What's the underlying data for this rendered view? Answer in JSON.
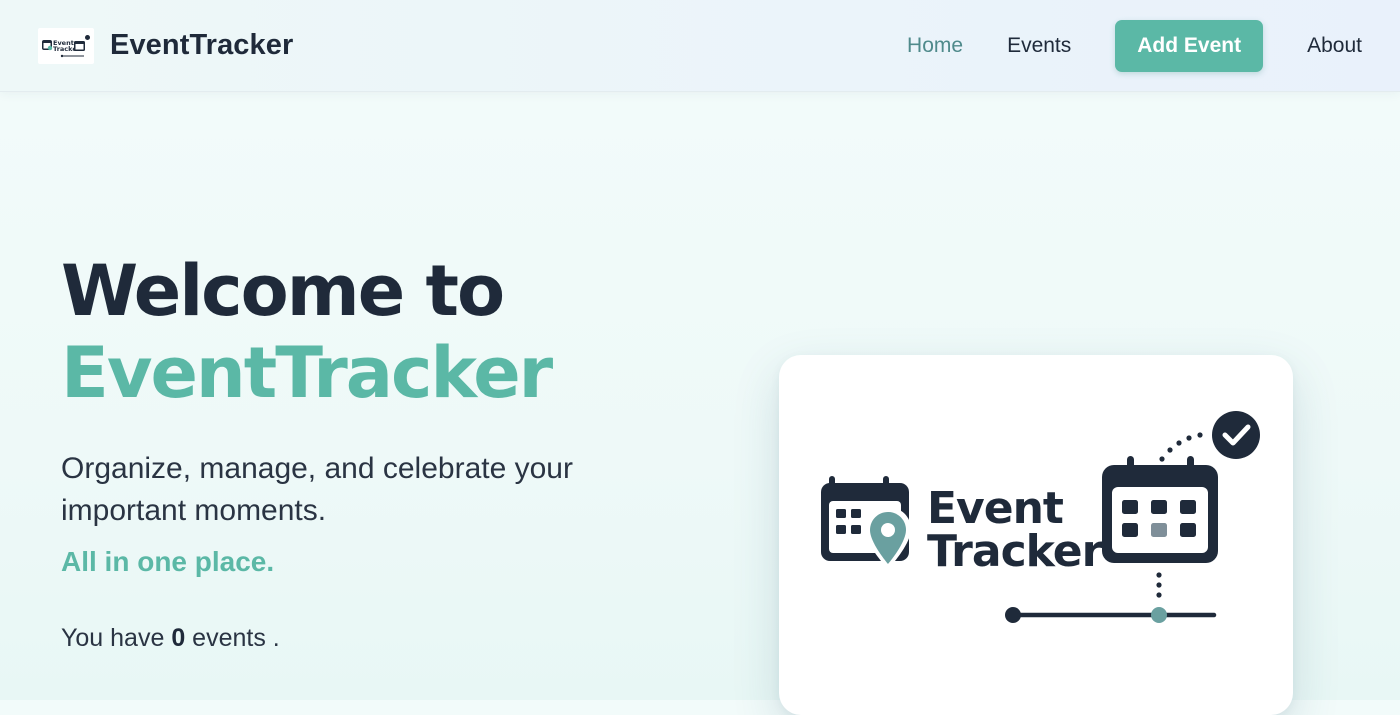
{
  "header": {
    "brand_name": "EventTracker",
    "brand_logo_text_line1": "Event",
    "brand_logo_text_line2": "Tracker",
    "nav": {
      "home": "Home",
      "events": "Events",
      "add_event": "Add Event",
      "about": "About"
    },
    "active_nav": "home"
  },
  "hero": {
    "title_line1": "Welcome to",
    "title_line2": "EventTracker",
    "subtitle": "Organize, manage, and celebrate your important moments.",
    "tagline": "All in one place.",
    "count_prefix": "You have",
    "count_value": "0",
    "count_suffix": "events ."
  },
  "card": {
    "logo_text_line1": "Event",
    "logo_text_line2": "Tracker"
  },
  "colors": {
    "accent": "#5bb8a6",
    "dark": "#1f2a3a",
    "active_nav": "#4f8a8b"
  },
  "icons": {
    "brand": "eventtracker-logo-icon",
    "calendar_pin": "calendar-pin-icon",
    "calendar": "calendar-icon",
    "check": "check-circle-icon",
    "timeline": "timeline-icon"
  }
}
